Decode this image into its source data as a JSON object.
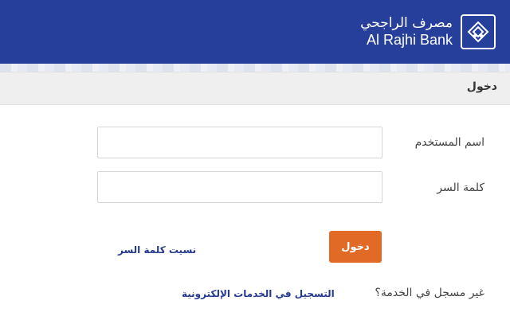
{
  "header": {
    "logo_arabic": "مصرف الراجحي",
    "logo_english": "Al Rajhi Bank",
    "logo_icon": "al-rajhi-mark"
  },
  "login": {
    "section_title": "دخول",
    "username_label": "اسم المستخدم",
    "username_value": "",
    "password_label": "كلمة السر",
    "password_value": "",
    "submit_label": "دخول",
    "forgot_password": "نسيت كلمة السر",
    "not_registered": "غير مسجل في الخدمة؟",
    "register_link": "التسجيل في الخدمات الإلكترونية"
  },
  "colors": {
    "header": "#263f9b",
    "button": "#e06a26",
    "link": "#233a8e"
  }
}
